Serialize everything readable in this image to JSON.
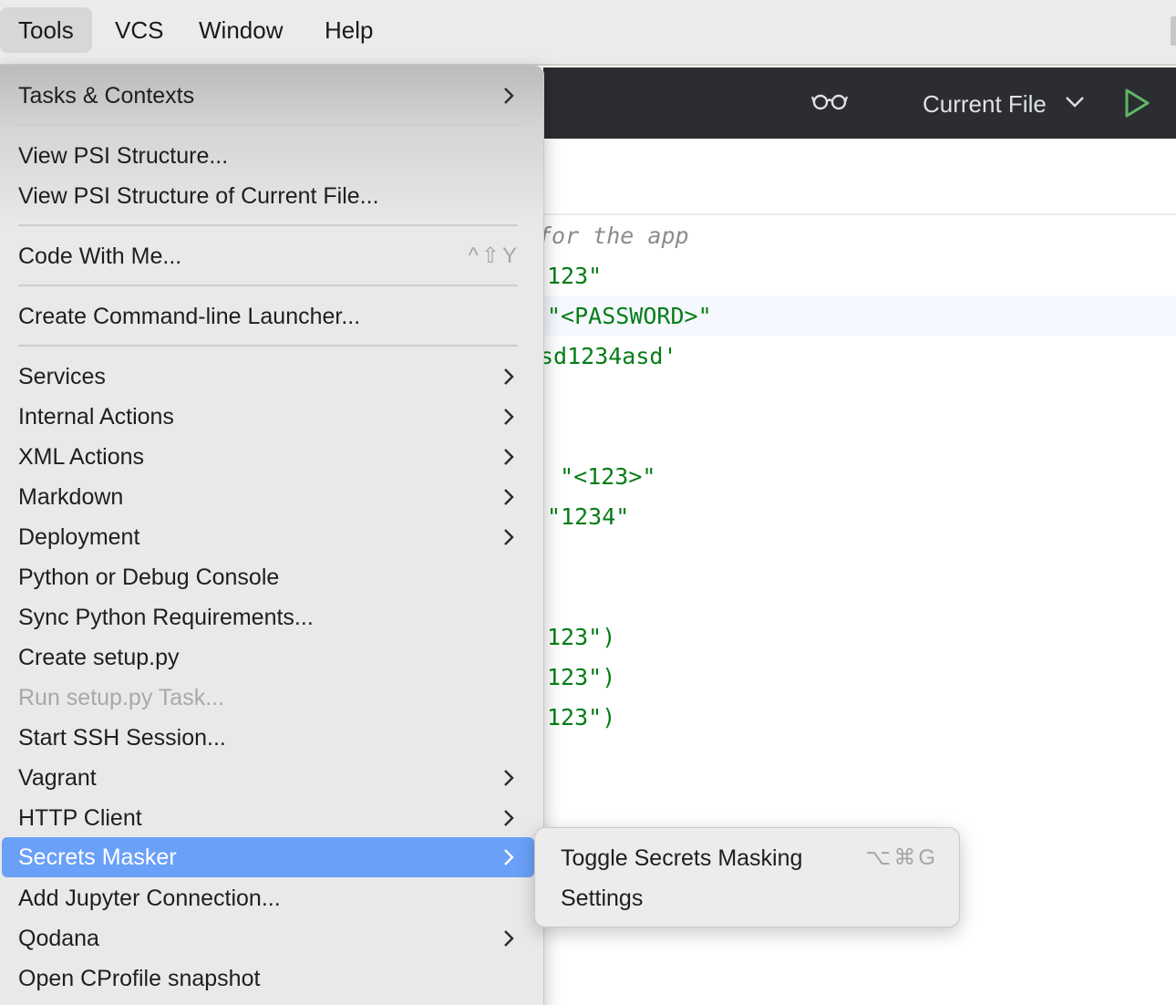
{
  "menubar": {
    "items": [
      "Tools",
      "VCS",
      "Window",
      "Help"
    ]
  },
  "toolbar": {
    "reader_mode_icon": "glasses-icon",
    "run_config_label": "Current File",
    "run_icon": "run-triangle-icon",
    "run_icon_color": "#5fb865"
  },
  "editor": {
    "lines": [
      "for the app",
      "123\"",
      "\"<PASSWORD>\"",
      "sd1234asd'",
      ": \"<123>\"",
      "\"1234\"",
      "123\")",
      "123\")",
      "123\")"
    ],
    "colors": {
      "string": "#067d17",
      "comment": "#8c8c8c"
    }
  },
  "menu": {
    "items": [
      {
        "label": "Tasks & Contexts",
        "submenu": true
      },
      {
        "label": "View PSI Structure..."
      },
      {
        "label": "View PSI Structure of Current File..."
      },
      {
        "label": "Code With Me...",
        "shortcut": "^⇧Y"
      },
      {
        "label": "Create Command-line Launcher..."
      },
      {
        "label": "Services",
        "submenu": true
      },
      {
        "label": "Internal Actions",
        "submenu": true
      },
      {
        "label": "XML Actions",
        "submenu": true
      },
      {
        "label": "Markdown",
        "submenu": true
      },
      {
        "label": "Deployment",
        "submenu": true
      },
      {
        "label": "Python or Debug Console"
      },
      {
        "label": "Sync Python Requirements..."
      },
      {
        "label": "Create setup.py"
      },
      {
        "label": "Run setup.py Task...",
        "disabled": true
      },
      {
        "label": "Start SSH Session..."
      },
      {
        "label": "Vagrant",
        "submenu": true
      },
      {
        "label": "HTTP Client",
        "submenu": true
      },
      {
        "label": "Secrets Masker",
        "submenu": true,
        "selected": true
      },
      {
        "label": "Add Jupyter Connection..."
      },
      {
        "label": "Qodana",
        "submenu": true
      },
      {
        "label": "Open CProfile snapshot"
      }
    ],
    "selection_color": "#6aa0f8"
  },
  "submenu": {
    "items": [
      {
        "label": "Toggle Secrets Masking",
        "shortcut": "⌥⌘G"
      },
      {
        "label": "Settings"
      }
    ]
  }
}
